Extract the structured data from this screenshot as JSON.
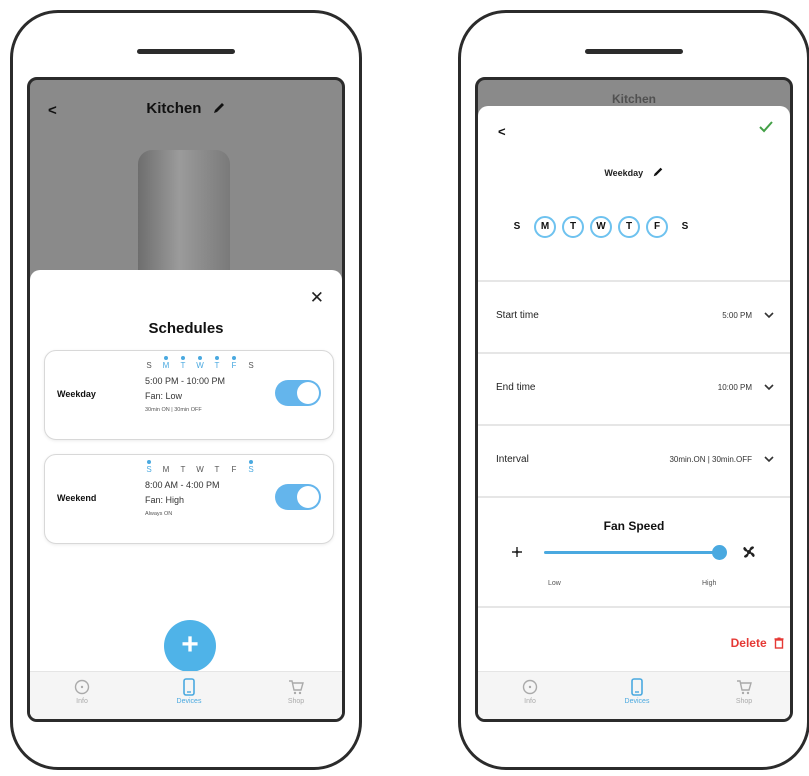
{
  "left_screen": {
    "header": {
      "back_label": "<",
      "title": "Kitchen"
    },
    "sheet": {
      "title": "Schedules",
      "close_label": "✕",
      "cards": [
        {
          "name": "Weekday",
          "days": [
            "S",
            "M",
            "T",
            "W",
            "T",
            "F",
            "S"
          ],
          "active_days": [
            false,
            true,
            true,
            true,
            true,
            true,
            false
          ],
          "times": "5:00 PM - 10:00 PM",
          "fan": "Fan: Low",
          "interval": "30min ON | 30min OFF",
          "enabled": true
        },
        {
          "name": "Weekend",
          "days": [
            "S",
            "M",
            "T",
            "W",
            "T",
            "F",
            "S"
          ],
          "active_days": [
            true,
            false,
            false,
            false,
            false,
            false,
            true
          ],
          "times": "8:00 AM - 4:00 PM",
          "fan": "Fan: High",
          "interval": "Always ON",
          "enabled": true
        }
      ],
      "add_label": "+"
    },
    "tabs": [
      {
        "label": "Info",
        "icon": "info-icon",
        "active": false
      },
      {
        "label": "Devices",
        "icon": "phone-icon",
        "active": true
      },
      {
        "label": "Shop",
        "icon": "cart-icon",
        "active": false
      }
    ]
  },
  "right_screen": {
    "background_title": "Kitchen",
    "editor": {
      "back_label": "<",
      "confirm_icon": "check-icon",
      "schedule_name": "Weekday",
      "days": [
        {
          "label": "S",
          "active": false
        },
        {
          "label": "M",
          "active": true
        },
        {
          "label": "T",
          "active": true
        },
        {
          "label": "W",
          "active": true
        },
        {
          "label": "T",
          "active": true
        },
        {
          "label": "F",
          "active": true
        },
        {
          "label": "S",
          "active": false
        }
      ],
      "start_time": {
        "label": "Start time",
        "value": "5:00 PM"
      },
      "end_time": {
        "label": "End time",
        "value": "10:00 PM"
      },
      "interval": {
        "label": "Interval",
        "value": "30min.ON | 30min.OFF"
      },
      "fan_speed": {
        "title": "Fan Speed",
        "low_label": "Low",
        "high_label": "High",
        "value": 1.0
      },
      "delete_label": "Delete"
    },
    "tabs": [
      {
        "label": "Info",
        "icon": "info-icon",
        "active": false
      },
      {
        "label": "Devices",
        "icon": "phone-icon",
        "active": true
      },
      {
        "label": "Shop",
        "icon": "cart-icon",
        "active": false
      }
    ]
  },
  "colors": {
    "accent": "#4aa9e0",
    "overlay": "#8a8a8a",
    "confirm": "#43a047",
    "danger": "#e53935"
  }
}
